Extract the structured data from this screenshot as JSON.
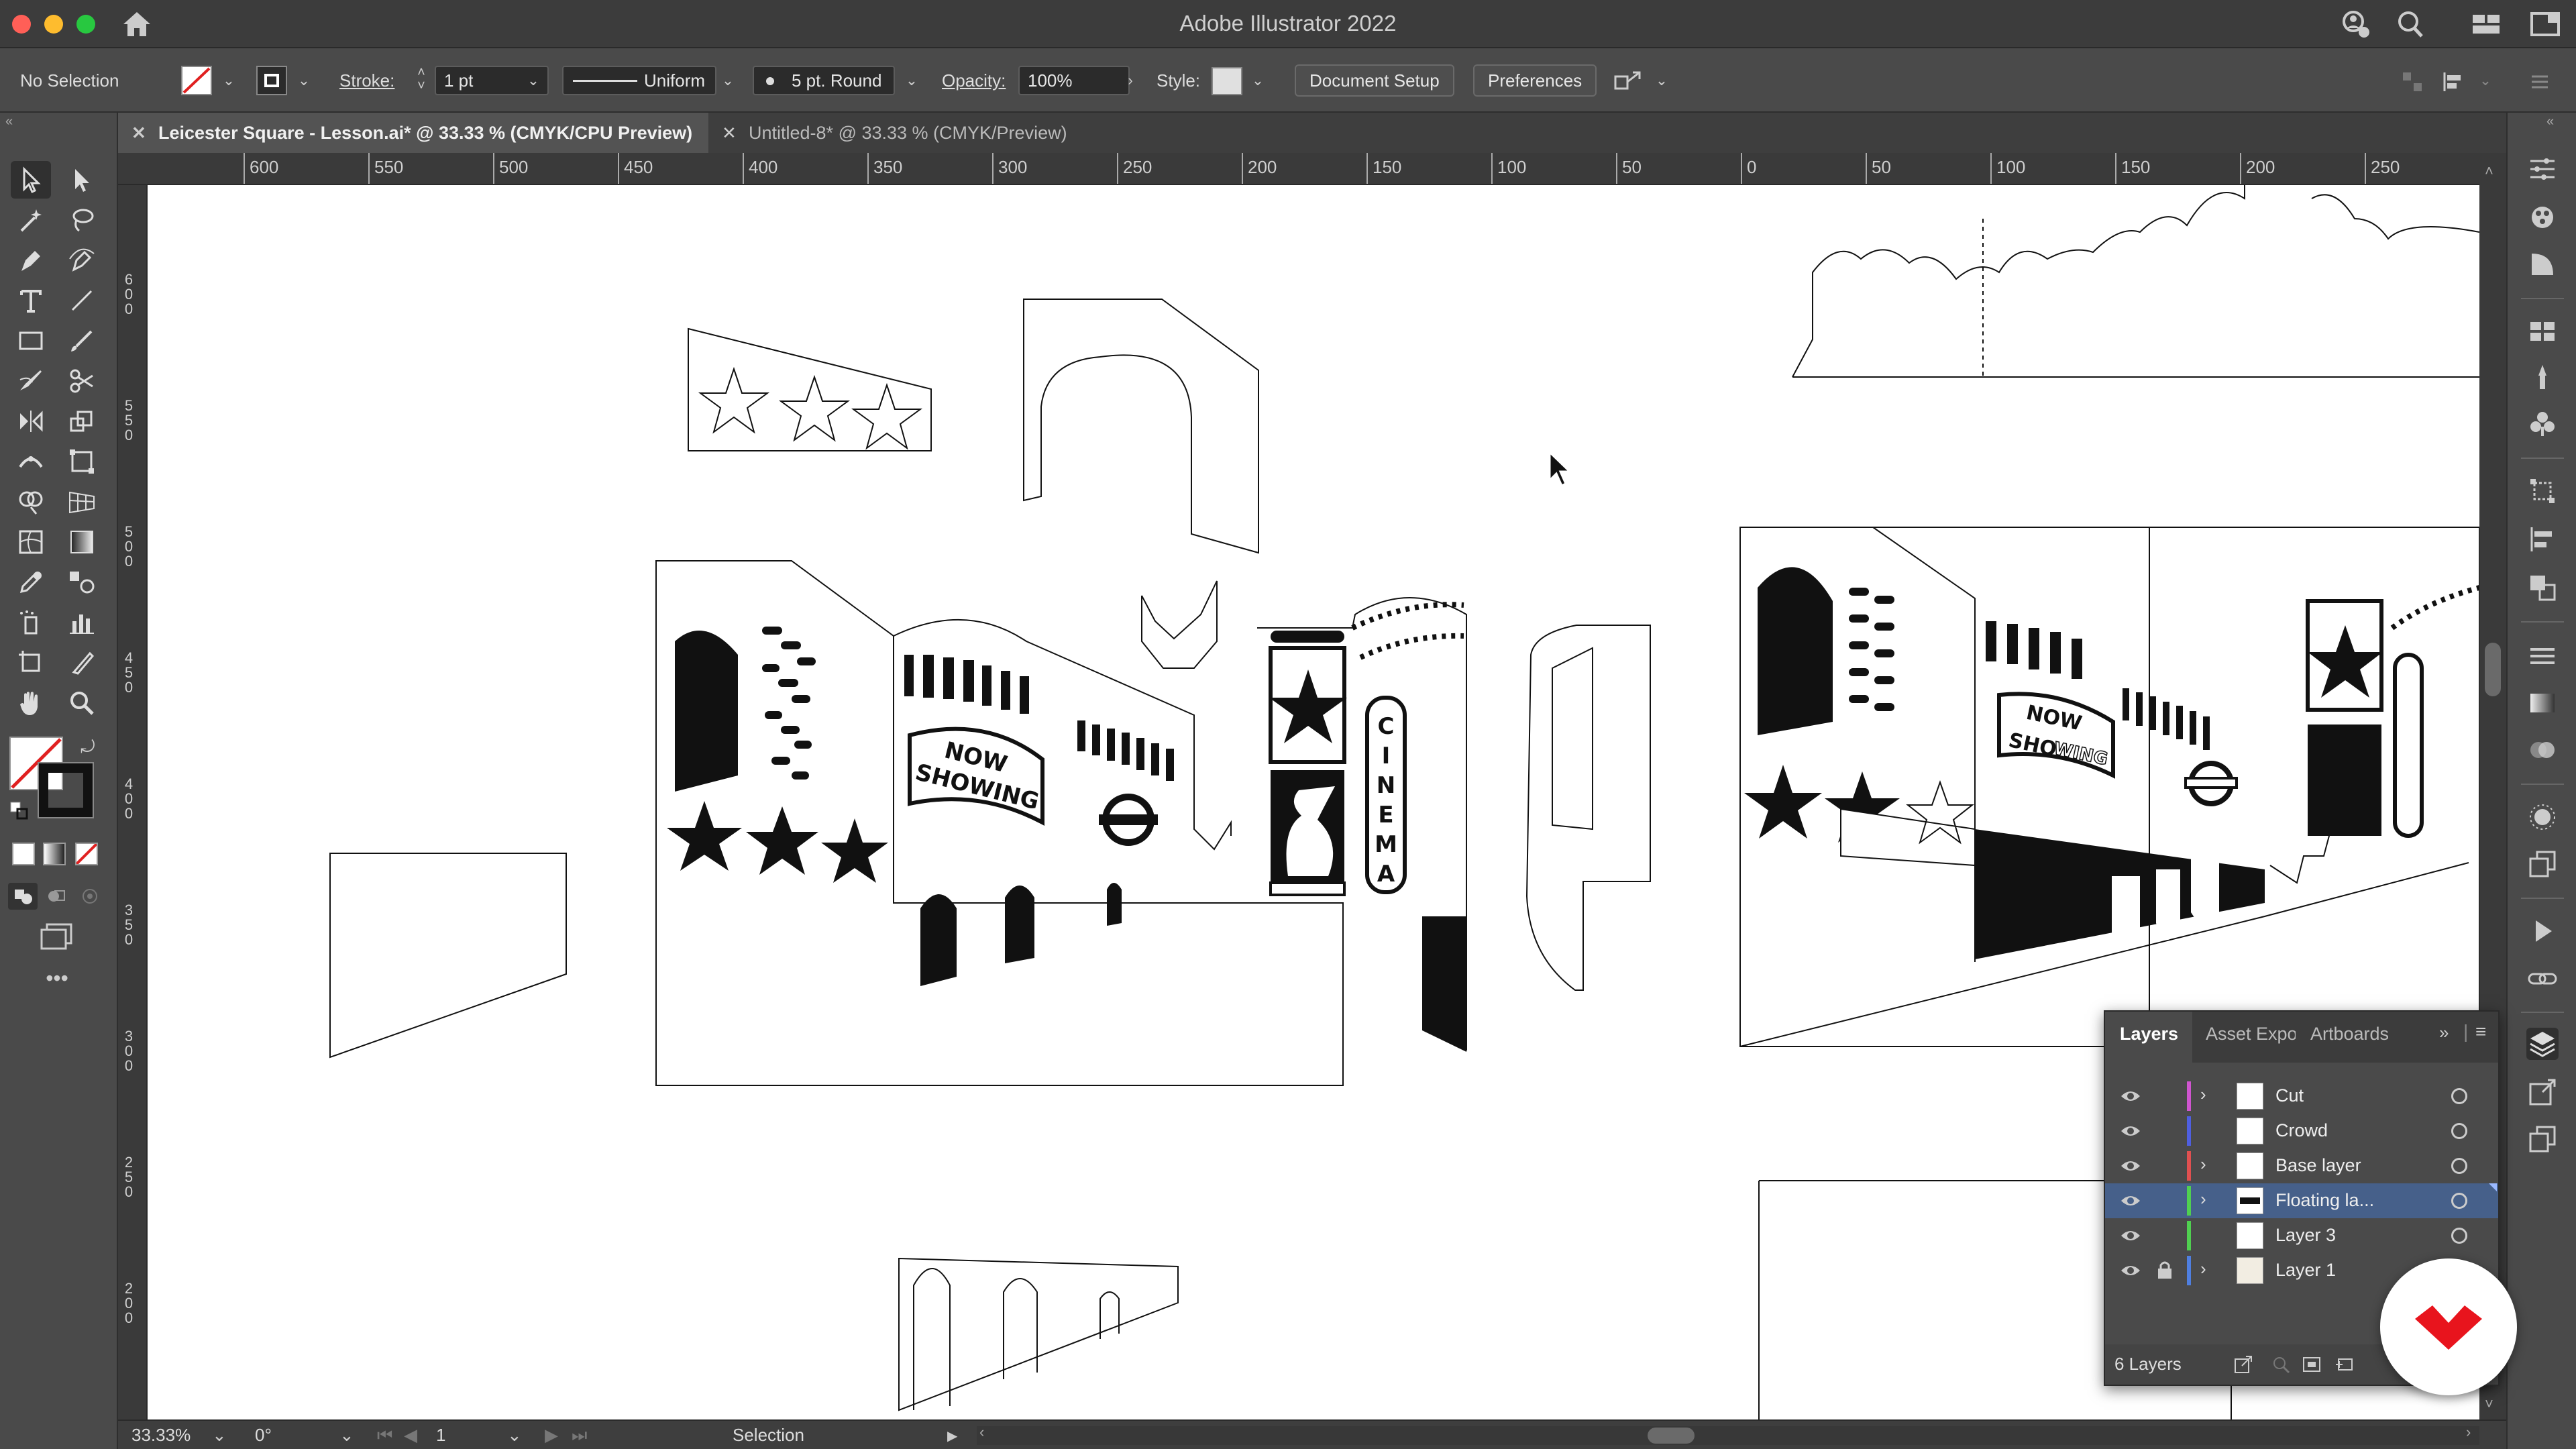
{
  "window": {
    "title": "Adobe Illustrator 2022"
  },
  "control_bar": {
    "selection_status": "No Selection",
    "stroke_label": "Stroke:",
    "stroke_weight": "1 pt",
    "stroke_profile": "Uniform",
    "brush": "5 pt. Round",
    "opacity_label": "Opacity:",
    "opacity_value": "100%",
    "style_label": "Style:",
    "document_setup": "Document Setup",
    "preferences": "Preferences"
  },
  "tabs": [
    {
      "label": "Leicester Square - Lesson.ai* @ 33.33 % (CMYK/CPU Preview)",
      "active": true
    },
    {
      "label": "Untitled-8* @ 33.33 % (CMYK/Preview)",
      "active": false
    }
  ],
  "ruler_h": [
    "600",
    "550",
    "500",
    "450",
    "400",
    "350",
    "300",
    "250",
    "200",
    "150",
    "100",
    "50",
    "0",
    "50",
    "100",
    "150",
    "200",
    "250"
  ],
  "ruler_v": [
    "600",
    "550",
    "500",
    "450",
    "400",
    "350",
    "300",
    "250",
    "200"
  ],
  "artwork": {
    "sign1": "NOW",
    "sign2": "SHOWING",
    "cinema_letters": [
      "C",
      "I",
      "N",
      "E",
      "M",
      "A"
    ],
    "sign3": "NOW",
    "sign4a": "SHO",
    "sign4b": "WING"
  },
  "status_bar": {
    "zoom": "33.33%",
    "rotation": "0°",
    "artboard": "1",
    "tool": "Selection"
  },
  "layers_panel": {
    "tabs": [
      "Layers",
      "Asset Expo",
      "Artboards"
    ],
    "layers": [
      {
        "name": "Cut",
        "color": "#d055d0",
        "expandable": true,
        "locked": false,
        "selected": false
      },
      {
        "name": "Crowd",
        "color": "#4f5fe0",
        "expandable": false,
        "locked": false,
        "selected": false
      },
      {
        "name": "Base layer",
        "color": "#e05050",
        "expandable": true,
        "locked": false,
        "selected": false
      },
      {
        "name": "Floating la...",
        "color": "#50d050",
        "expandable": true,
        "locked": false,
        "selected": true
      },
      {
        "name": "Layer 3",
        "color": "#50d050",
        "expandable": false,
        "locked": false,
        "selected": false
      },
      {
        "name": "Layer 1",
        "color": "#4f7fe0",
        "expandable": true,
        "locked": true,
        "selected": false
      }
    ],
    "count": "6 Layers"
  }
}
